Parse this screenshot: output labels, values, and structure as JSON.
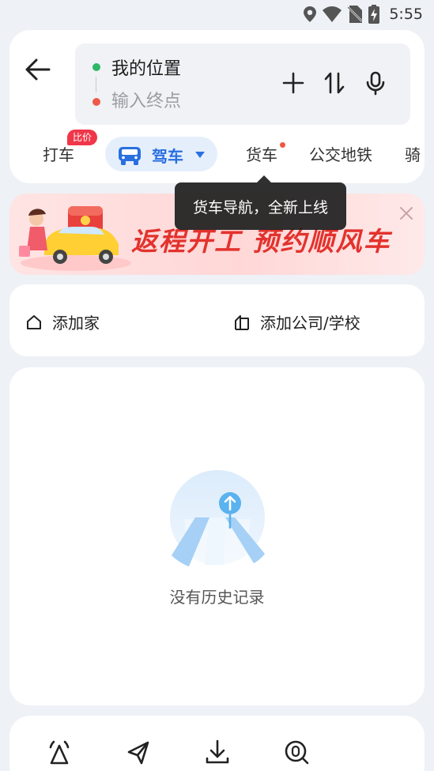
{
  "status_bar": {
    "time": "5:55",
    "icons": [
      "location-icon",
      "wifi-icon",
      "no-sim-icon",
      "battery-charging-icon"
    ]
  },
  "route": {
    "start": "我的位置",
    "end_placeholder": "输入终点",
    "start_color": "#2cb866",
    "end_color": "#ee5a4a"
  },
  "tabs": {
    "taxi": "打车",
    "taxi_badge": "比价",
    "driving": "驾车",
    "truck": "货车",
    "transit": "公交地铁",
    "ride": "骑",
    "accent": "#2a6fe0"
  },
  "tooltip": "货车导航，全新上线",
  "banner": {
    "text": "返程开工 预约顺风车"
  },
  "addresses": {
    "home": "添加家",
    "work": "添加公司/学校"
  },
  "history": {
    "empty_text": "没有历史记录"
  }
}
